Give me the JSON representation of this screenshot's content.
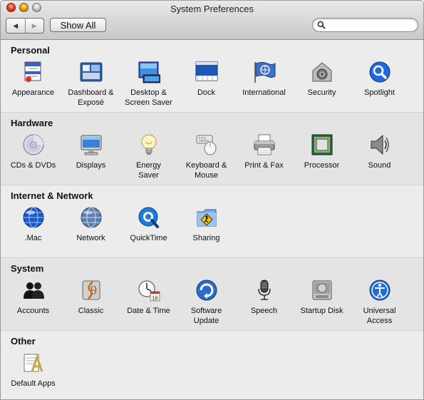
{
  "window": {
    "title": "System Preferences"
  },
  "toolbar": {
    "back_glyph": "◀",
    "forward_glyph": "▶",
    "show_all_label": "Show All",
    "search_placeholder": "",
    "search_value": ""
  },
  "sections": [
    {
      "title": "Personal",
      "items": [
        {
          "label": "Appearance",
          "icon": "appearance-icon"
        },
        {
          "label": "Dashboard &\nExposé",
          "icon": "dashboard-expose-icon"
        },
        {
          "label": "Desktop &\nScreen Saver",
          "icon": "desktop-screensaver-icon"
        },
        {
          "label": "Dock",
          "icon": "dock-icon"
        },
        {
          "label": "International",
          "icon": "international-icon"
        },
        {
          "label": "Security",
          "icon": "security-icon"
        },
        {
          "label": "Spotlight",
          "icon": "spotlight-icon"
        }
      ]
    },
    {
      "title": "Hardware",
      "items": [
        {
          "label": "CDs & DVDs",
          "icon": "cd-dvd-icon"
        },
        {
          "label": "Displays",
          "icon": "displays-icon"
        },
        {
          "label": "Energy\nSaver",
          "icon": "energy-saver-icon"
        },
        {
          "label": "Keyboard &\nMouse",
          "icon": "keyboard-mouse-icon"
        },
        {
          "label": "Print & Fax",
          "icon": "print-fax-icon"
        },
        {
          "label": "Processor",
          "icon": "processor-icon"
        },
        {
          "label": "Sound",
          "icon": "sound-icon"
        }
      ]
    },
    {
      "title": "Internet & Network",
      "items": [
        {
          "label": ".Mac",
          "icon": "dotmac-icon"
        },
        {
          "label": "Network",
          "icon": "network-icon"
        },
        {
          "label": "QuickTime",
          "icon": "quicktime-icon"
        },
        {
          "label": "Sharing",
          "icon": "sharing-icon"
        }
      ]
    },
    {
      "title": "System",
      "items": [
        {
          "label": "Accounts",
          "icon": "accounts-icon"
        },
        {
          "label": "Classic",
          "icon": "classic-icon"
        },
        {
          "label": "Date & Time",
          "icon": "date-time-icon",
          "badge": "18"
        },
        {
          "label": "Software\nUpdate",
          "icon": "software-update-icon"
        },
        {
          "label": "Speech",
          "icon": "speech-icon"
        },
        {
          "label": "Startup Disk",
          "icon": "startup-disk-icon"
        },
        {
          "label": "Universal\nAccess",
          "icon": "universal-access-icon"
        }
      ]
    },
    {
      "title": "Other",
      "items": [
        {
          "label": "Default Apps",
          "icon": "default-apps-icon"
        }
      ]
    }
  ]
}
